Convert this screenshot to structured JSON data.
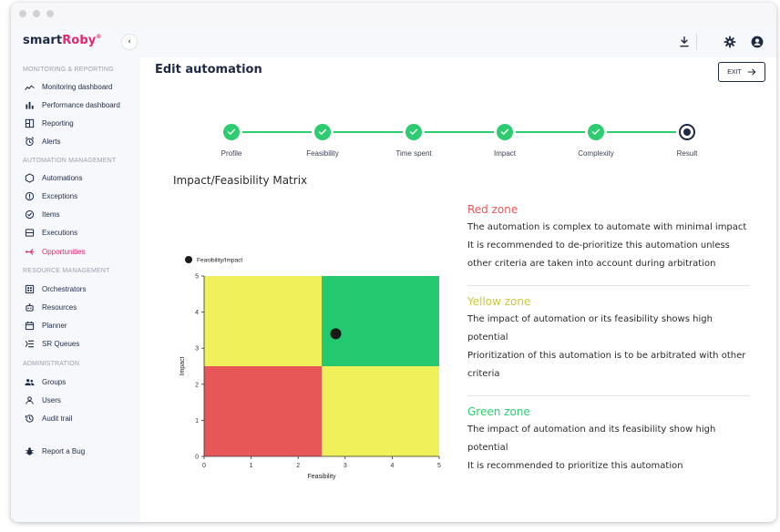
{
  "app": {
    "logo_prefix": "smart",
    "logo_accent": "Roby",
    "logo_mark": "®",
    "collapse_glyph": "‹"
  },
  "colors": {
    "accent": "#e3266f",
    "navy": "#1e2a44",
    "success": "#2ecc71",
    "red_zone": "#e85757",
    "yellow_zone": "#eff05a",
    "green_zone": "#24c86f"
  },
  "sidebar": {
    "sections": [
      {
        "title": "MONITORING & REPORTING",
        "items": [
          {
            "label": "Monitoring dashboard",
            "icon": "trend-line-icon"
          },
          {
            "label": "Performance dashboard",
            "icon": "bar-chart-icon"
          },
          {
            "label": "Reporting",
            "icon": "layout-icon"
          },
          {
            "label": "Alerts",
            "icon": "alarm-icon"
          }
        ]
      },
      {
        "title": "AUTOMATION MANAGEMENT",
        "items": [
          {
            "label": "Automations",
            "icon": "hexagon-icon"
          },
          {
            "label": "Exceptions",
            "icon": "alert-circle-icon"
          },
          {
            "label": "Items",
            "icon": "check-circle-icon"
          },
          {
            "label": "Executions",
            "icon": "server-icon"
          },
          {
            "label": "Opportunities",
            "icon": "branch-icon",
            "active": true
          }
        ]
      },
      {
        "title": "RESOURCE MANAGEMENT",
        "items": [
          {
            "label": "Orchestrators",
            "icon": "grid-icon"
          },
          {
            "label": "Resources",
            "icon": "robot-icon"
          },
          {
            "label": "Planner",
            "icon": "calendar-icon"
          },
          {
            "label": "SR Queues",
            "icon": "queue-icon"
          }
        ]
      },
      {
        "title": "ADMINISTRATION",
        "items": [
          {
            "label": "Groups",
            "icon": "users-icon"
          },
          {
            "label": "Users",
            "icon": "user-icon"
          },
          {
            "label": "Audit trail",
            "icon": "history-icon"
          }
        ]
      }
    ],
    "bug_report": {
      "label": "Report a Bug",
      "icon": "bug-icon"
    }
  },
  "topbar": {
    "icons": [
      "download-icon",
      "gear-icon",
      "account-icon"
    ]
  },
  "page": {
    "title": "Edit automation",
    "exit_label": "EXIT",
    "exit_icon": "arrow-right-icon"
  },
  "stepper": {
    "steps": [
      {
        "label": "Profile",
        "state": "done"
      },
      {
        "label": "Feasibility",
        "state": "done"
      },
      {
        "label": "Time spent",
        "state": "done"
      },
      {
        "label": "Impact",
        "state": "done"
      },
      {
        "label": "Complexity",
        "state": "done"
      },
      {
        "label": "Result",
        "state": "current"
      }
    ]
  },
  "matrix": {
    "title": "Impact/Feasibility Matrix"
  },
  "chart_data": {
    "type": "scatter",
    "title": "",
    "xlabel": "Feasibility",
    "ylabel": "Impact",
    "xlim": [
      0,
      5
    ],
    "ylim": [
      0,
      5
    ],
    "xticks": [
      "0",
      "1",
      "2",
      "3",
      "4",
      "5"
    ],
    "yticks": [
      "0",
      "1",
      "2",
      "3",
      "4",
      "5"
    ],
    "legend": "top-left",
    "grid": false,
    "zones": [
      {
        "x": [
          0,
          2.5
        ],
        "y": [
          2.5,
          5
        ],
        "color": "#eff05a"
      },
      {
        "x": [
          2.5,
          5
        ],
        "y": [
          2.5,
          5
        ],
        "color": "#24c86f"
      },
      {
        "x": [
          0,
          2.5
        ],
        "y": [
          0,
          2.5
        ],
        "color": "#e85757"
      },
      {
        "x": [
          2.5,
          5
        ],
        "y": [
          0,
          2.5
        ],
        "color": "#eff05a"
      }
    ],
    "series": [
      {
        "name": "Feasibility/Impact",
        "x": [
          2.8
        ],
        "y": [
          3.4
        ],
        "color": "#1a1a1a"
      }
    ]
  },
  "zones_info": [
    {
      "title": "Red zone",
      "color": "#e85757",
      "lines": [
        "The automation is complex to automate with minimal impact",
        "It is recommended to de-prioritize this automation unless other criteria are taken into account during arbitration"
      ]
    },
    {
      "title": "Yellow zone",
      "color": "#c8c83a",
      "lines": [
        "The impact of automation or its feasibility shows high potential",
        "Prioritization of this automation is to be arbitrated with other criteria"
      ]
    },
    {
      "title": "Green zone",
      "color": "#2ecc71",
      "lines": [
        "The impact of automation and its feasibility show high potential",
        "It is recommended to prioritize this automation"
      ]
    }
  ]
}
